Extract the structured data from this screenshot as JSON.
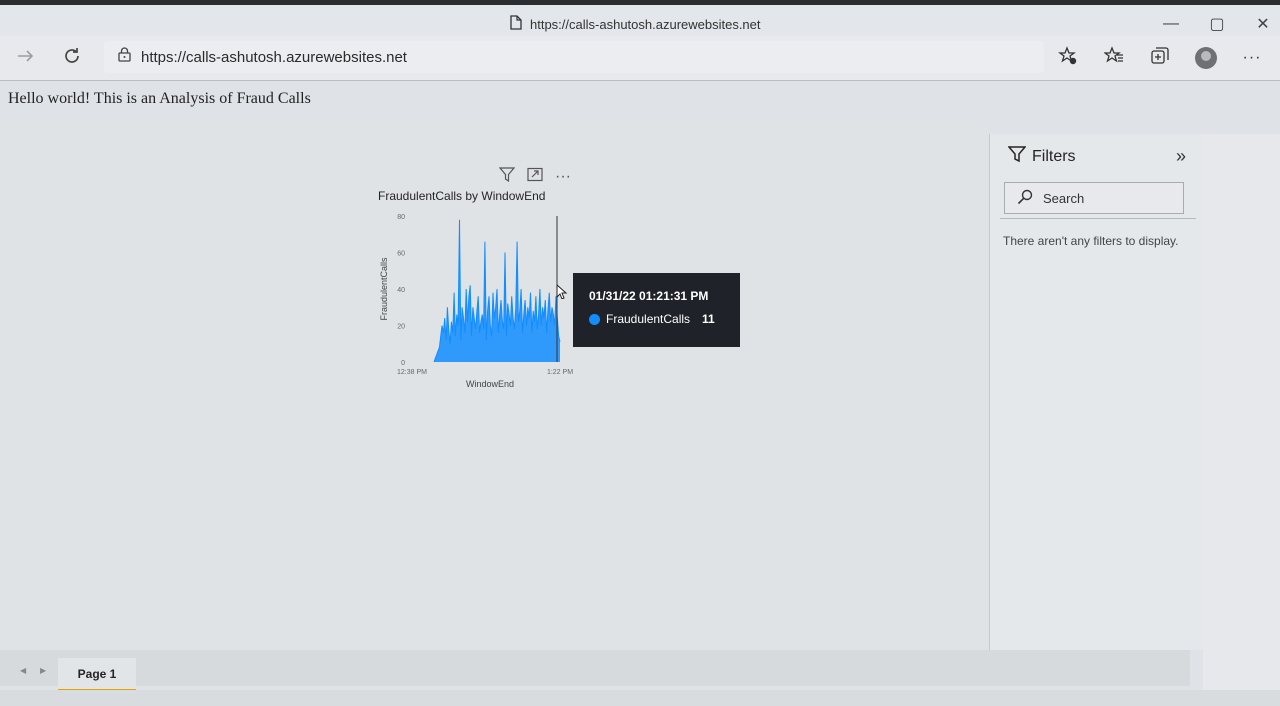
{
  "browser": {
    "tab_title": "https://calls-ashutosh.azurewebsites.net",
    "address": "https://calls-ashutosh.azurewebsites.net",
    "window_controls": {
      "minimize": "—",
      "maximize": "▢",
      "close": "✕"
    }
  },
  "page": {
    "heading": "Hello world! This is an Analysis of Fraud Calls"
  },
  "visual": {
    "title": "FraudulentCalls by WindowEnd",
    "more_label": "···"
  },
  "tooltip": {
    "date": "01/31/22 01:21:31 PM",
    "series": "FraudulentCalls",
    "value": "11"
  },
  "filters": {
    "title": "Filters",
    "expand_label": "»",
    "search_placeholder": "Search",
    "empty_message": "There aren't any filters to display."
  },
  "page_tabs": {
    "tabs": [
      "Page 1"
    ],
    "active": 0
  },
  "colors": {
    "series": "#118dff",
    "tab_underline": "#e1a400",
    "tooltip_bg": "#1f2228"
  },
  "chart_data": {
    "type": "area",
    "title": "FraudulentCalls by WindowEnd",
    "xlabel": "WindowEnd",
    "ylabel": "FraudulentCalls",
    "ylim": [
      0,
      80
    ],
    "y_ticks": [
      0,
      20,
      40,
      60,
      80
    ],
    "x_tick_labels": [
      "12:38 PM",
      "1:22 PM"
    ],
    "grid": false,
    "series": [
      {
        "name": "FraudulentCalls",
        "values": [
          0,
          2,
          4,
          6,
          8,
          14,
          20,
          16,
          24,
          12,
          30,
          18,
          10,
          22,
          16,
          38,
          14,
          26,
          20,
          78,
          12,
          30,
          24,
          16,
          40,
          22,
          36,
          42,
          14,
          30,
          24,
          18,
          28,
          36,
          16,
          22,
          26,
          18,
          66,
          12,
          28,
          36,
          20,
          14,
          38,
          24,
          30,
          40,
          16,
          26,
          34,
          22,
          18,
          60,
          14,
          32,
          26,
          20,
          36,
          24,
          18,
          30,
          66,
          22,
          28,
          40,
          16,
          26,
          34,
          20,
          30,
          24,
          38,
          16,
          28,
          22,
          36,
          18,
          26,
          40,
          20,
          30,
          24,
          34,
          16,
          28,
          38,
          22,
          30,
          26,
          20,
          36,
          24,
          14,
          11
        ]
      }
    ]
  }
}
